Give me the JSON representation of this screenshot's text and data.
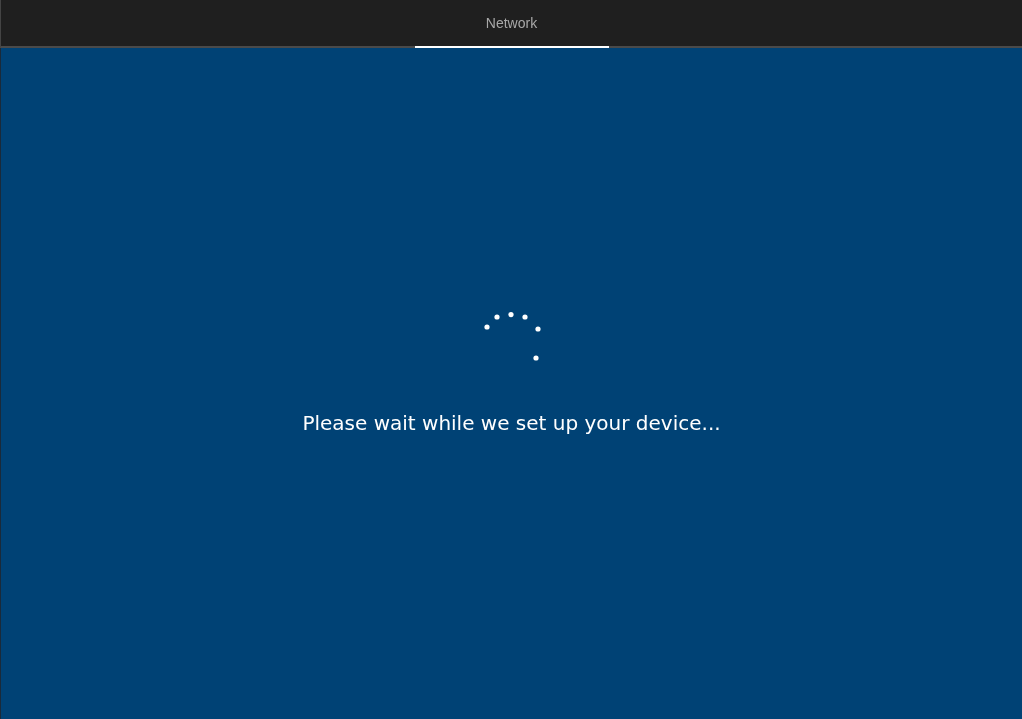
{
  "tabs": [
    {
      "label": "Network",
      "selected": true
    }
  ],
  "message": "Please wait while we set up your device..."
}
